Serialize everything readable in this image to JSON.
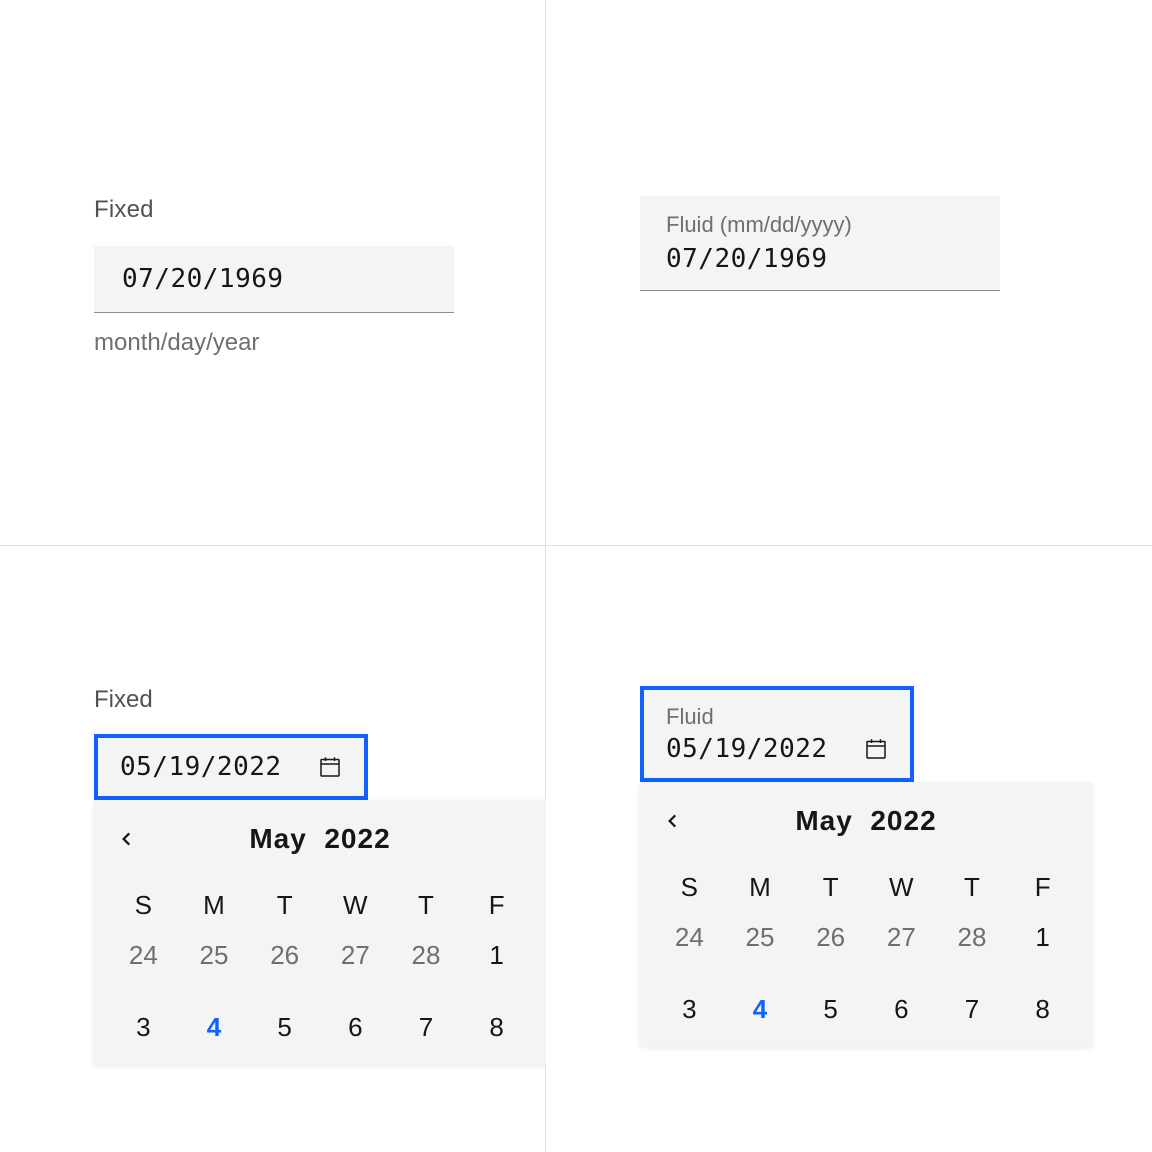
{
  "quad1": {
    "label": "Fixed",
    "value": "07/20/1969",
    "helper": "month/day/year"
  },
  "quad2": {
    "label": "Fluid (mm/dd/yyyy)",
    "value": "07/20/1969"
  },
  "quad3": {
    "label": "Fixed",
    "value": "05/19/2022",
    "calendar": {
      "month_label": "May",
      "year_label": "2022",
      "dow": [
        "S",
        "M",
        "T",
        "W",
        "T",
        "F"
      ],
      "rows": [
        [
          {
            "n": "24",
            "muted": true
          },
          {
            "n": "25",
            "muted": true
          },
          {
            "n": "26",
            "muted": true
          },
          {
            "n": "27",
            "muted": true
          },
          {
            "n": "28",
            "muted": true
          },
          {
            "n": "1",
            "muted": false
          }
        ],
        [
          {
            "n": "3",
            "muted": false
          },
          {
            "n": "4",
            "muted": false,
            "today": true
          },
          {
            "n": "5",
            "muted": false
          },
          {
            "n": "6",
            "muted": false
          },
          {
            "n": "7",
            "muted": false
          },
          {
            "n": "8",
            "muted": false
          }
        ]
      ]
    }
  },
  "quad4": {
    "label": "Fluid",
    "value": "05/19/2022",
    "calendar": {
      "month_label": "May",
      "year_label": "2022",
      "dow": [
        "S",
        "M",
        "T",
        "W",
        "T",
        "F"
      ],
      "rows": [
        [
          {
            "n": "24",
            "muted": true
          },
          {
            "n": "25",
            "muted": true
          },
          {
            "n": "26",
            "muted": true
          },
          {
            "n": "27",
            "muted": true
          },
          {
            "n": "28",
            "muted": true
          },
          {
            "n": "1",
            "muted": false
          }
        ],
        [
          {
            "n": "3",
            "muted": false
          },
          {
            "n": "4",
            "muted": false,
            "today": true
          },
          {
            "n": "5",
            "muted": false
          },
          {
            "n": "6",
            "muted": false
          },
          {
            "n": "7",
            "muted": false
          },
          {
            "n": "8",
            "muted": false
          }
        ]
      ]
    }
  },
  "colors": {
    "focus": "#0f62fe",
    "field_bg": "#f4f4f4",
    "border": "#8d8d8d",
    "muted": "#6f6f6f"
  }
}
